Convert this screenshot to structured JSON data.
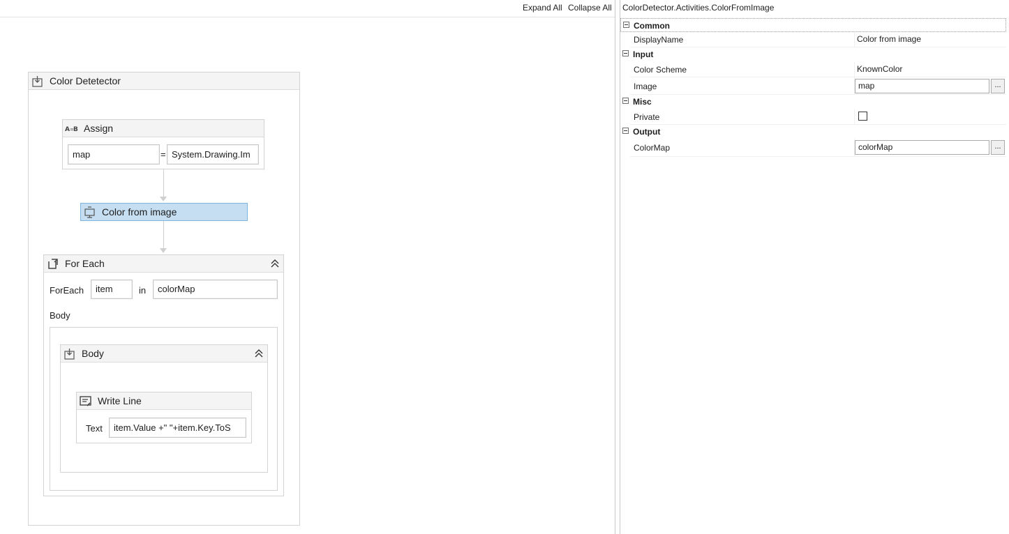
{
  "toolbar": {
    "expand_all": "Expand All",
    "collapse_all": "Collapse All"
  },
  "sequence": {
    "title": "Color Detetector",
    "assign": {
      "title": "Assign",
      "to_value": "map",
      "equals": "=",
      "value_expr": "System.Drawing.Im"
    },
    "color_from_image": {
      "title": "Color from image"
    },
    "for_each": {
      "title": "For Each",
      "foreach_label": "ForEach",
      "item_value": "item",
      "in_label": "in",
      "collection_value": "colorMap",
      "body_label": "Body",
      "body_sequence": {
        "title": "Body",
        "write_line": {
          "title": "Write Line",
          "text_label": "Text",
          "text_value": "item.Value +\" \"+item.Key.ToS"
        }
      }
    }
  },
  "properties": {
    "title": "ColorDetector.Activities.ColorFromImage",
    "categories": [
      {
        "label": "Common"
      },
      {
        "label": "Input"
      },
      {
        "label": "Misc"
      },
      {
        "label": "Output"
      }
    ],
    "rows": {
      "display_name": {
        "name": "DisplayName",
        "value": "Color from image"
      },
      "color_scheme": {
        "name": "Color Scheme",
        "value": "KnownColor"
      },
      "image": {
        "name": "Image",
        "value": "map",
        "button": "..."
      },
      "private": {
        "name": "Private",
        "checked": false
      },
      "color_map": {
        "name": "ColorMap",
        "value": "colorMap",
        "button": "..."
      }
    }
  },
  "colors": {
    "selected_fill": "#c5def1",
    "selected_border": "#7eb4e0",
    "header_fill": "#f4f4f4"
  },
  "icons": [
    "sequence-icon",
    "assign-icon",
    "activity-icon",
    "foreach-icon",
    "collapse-icon",
    "writeline-icon"
  ]
}
